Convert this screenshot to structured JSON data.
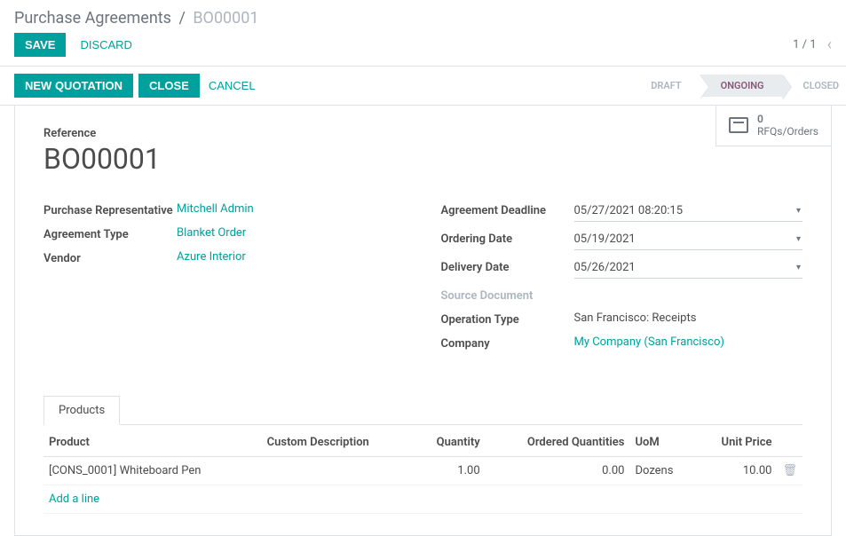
{
  "breadcrumb": {
    "parent": "Purchase Agreements",
    "current": "BO00001"
  },
  "actions": {
    "save": "SAVE",
    "discard": "DISCARD"
  },
  "pager": {
    "text": "1 / 1"
  },
  "statusbar": {
    "new_quotation": "NEW QUOTATION",
    "close": "CLOSE",
    "cancel": "CANCEL",
    "steps": {
      "draft": "DRAFT",
      "ongoing": "ONGOING",
      "closed": "CLOSED"
    }
  },
  "stat": {
    "count": "0",
    "label": "RFQs/Orders"
  },
  "reference": {
    "label": "Reference",
    "value": "BO00001"
  },
  "left_fields": {
    "rep_label": "Purchase Representative",
    "rep_value": "Mitchell Admin",
    "type_label": "Agreement Type",
    "type_value": "Blanket Order",
    "vendor_label": "Vendor",
    "vendor_value": "Azure Interior"
  },
  "right_fields": {
    "deadline_label": "Agreement Deadline",
    "deadline_value": "05/27/2021 08:20:15",
    "ordering_label": "Ordering Date",
    "ordering_value": "05/19/2021",
    "delivery_label": "Delivery Date",
    "delivery_value": "05/26/2021",
    "source_label": "Source Document",
    "optype_label": "Operation Type",
    "optype_value": "San Francisco: Receipts",
    "company_label": "Company",
    "company_value": "My Company (San Francisco)"
  },
  "tabs": {
    "products": "Products"
  },
  "table": {
    "h_product": "Product",
    "h_desc": "Custom Description",
    "h_qty": "Quantity",
    "h_ordered": "Ordered Quantities",
    "h_uom": "UoM",
    "h_price": "Unit Price",
    "rows": [
      {
        "product": "[CONS_0001] Whiteboard Pen",
        "desc": "",
        "qty": "1.00",
        "ordered": "0.00",
        "uom": "Dozens",
        "price": "10.00"
      }
    ],
    "add_line": "Add a line"
  }
}
